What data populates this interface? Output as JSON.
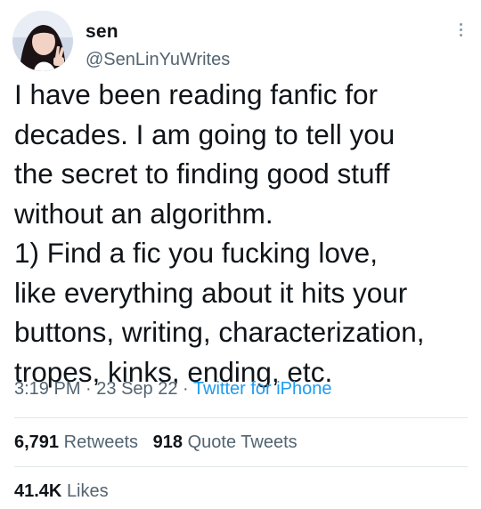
{
  "author": {
    "name": "sen",
    "handle": "@SenLinYuWrites",
    "avatar_icon": "profile-photo"
  },
  "tweet": {
    "text": "I have been reading fanfic for\ndecades. I am going to tell you\nthe secret to finding good stuff\nwithout an algorithm.\n1) Find a fic you fucking love,\nlike everything about it hits your\nbuttons, writing, characterization,\ntropes, kinks, ending, etc."
  },
  "meta": {
    "time": "3:19 PM",
    "separator": " · ",
    "date": "23 Sep 22",
    "source": "Twitter for iPhone"
  },
  "stats": {
    "retweets_count": "6,791",
    "retweets_label": "Retweets",
    "quotes_count": "918",
    "quotes_label": "Quote Tweets",
    "likes_count": "41.4K",
    "likes_label": "Likes"
  },
  "colors": {
    "text": "#0f1419",
    "secondary": "#536471",
    "link": "#1d9bf0",
    "divider": "#e1e6ea"
  }
}
